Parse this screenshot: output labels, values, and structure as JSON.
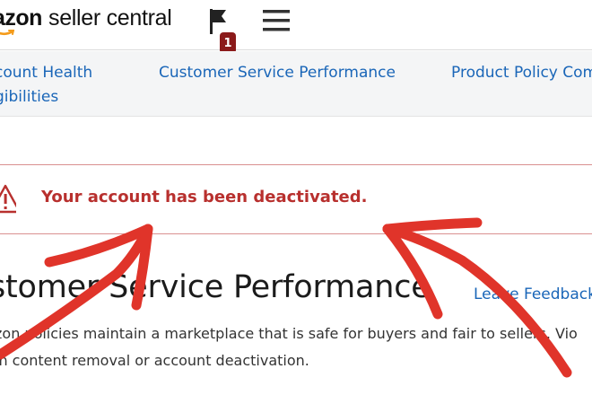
{
  "header": {
    "logo_brand": "azon",
    "logo_product": "seller central",
    "flag_count": "1"
  },
  "tabs": [
    {
      "line1": "count Health",
      "line2": "gibilities"
    },
    {
      "line1": "Customer Service Performance",
      "line2": ""
    },
    {
      "line1": "Product Policy Com",
      "line2": ""
    }
  ],
  "alert": {
    "message": "Your account has been deactivated."
  },
  "main": {
    "title": "stomer Service Performance",
    "feedback_link": "Leave Feedback",
    "description_line1": "zon policies maintain a marketplace that is safe for buyers and fair to sellers. Vio",
    "description_line2": "in content removal or account deactivation."
  },
  "colors": {
    "alert_red": "#b8302e",
    "link_blue": "#1a66b8",
    "arrow_red": "#e0342a",
    "badge_red": "#8b1a1a"
  }
}
